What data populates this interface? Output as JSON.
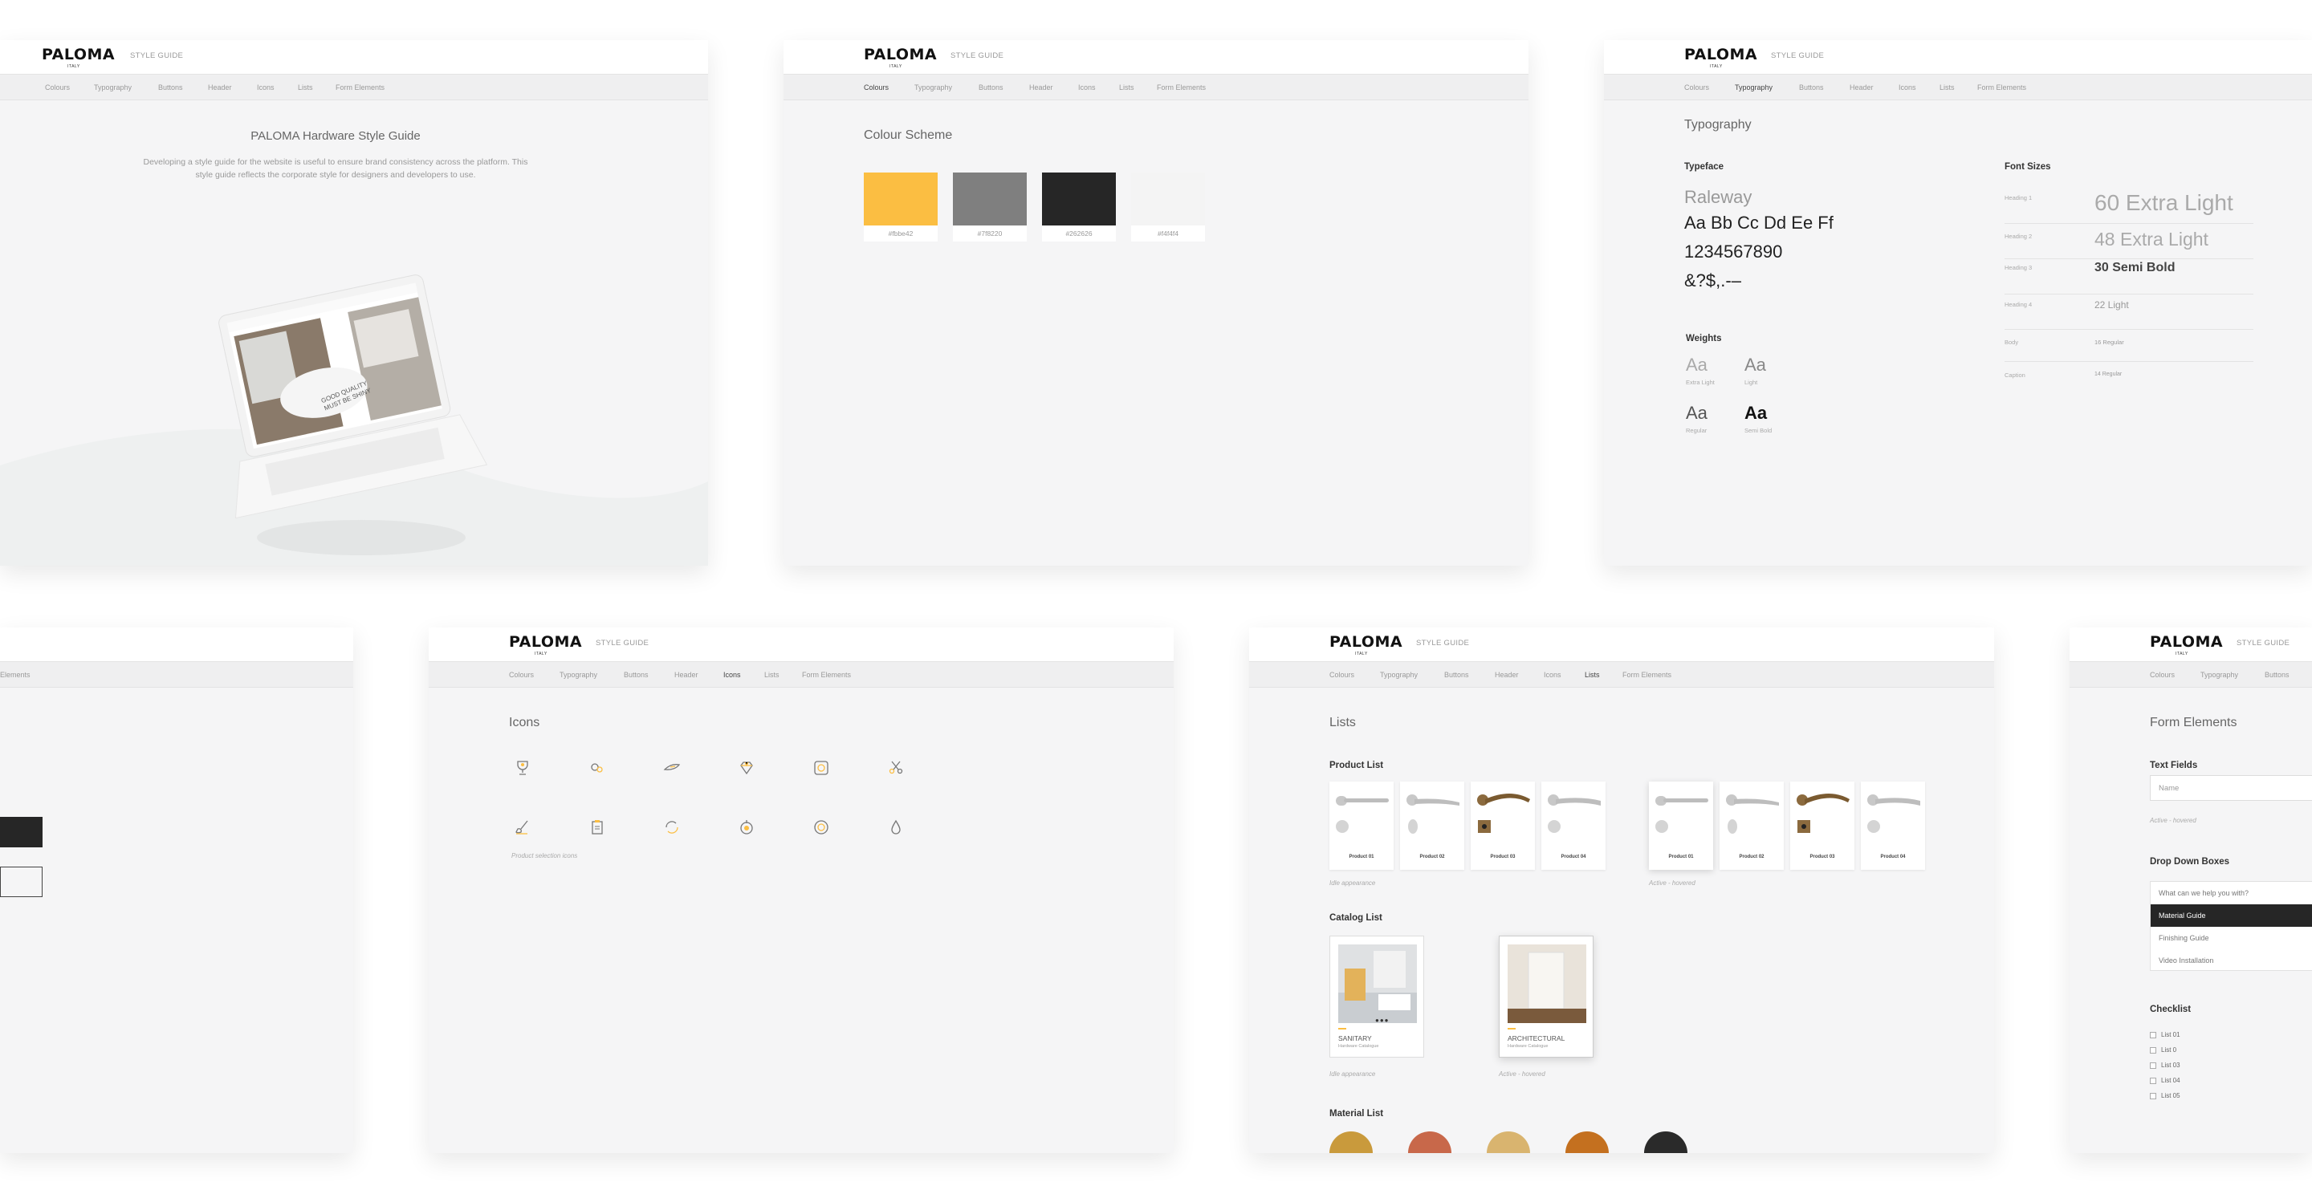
{
  "brand": {
    "logo": "PALOMA",
    "logo_sub": "ITALY",
    "section_label": "STYLE GUIDE"
  },
  "nav": [
    "Colours",
    "Typography",
    "Buttons",
    "Header",
    "Icons",
    "Lists",
    "Form Elements"
  ],
  "nav_partial": "Elements",
  "intro": {
    "title": "PALOMA Hardware Style Guide",
    "description_line1": "Developing a style guide for the website is useful to ensure brand consistency across the platform. This",
    "description_line2": "style guide reflects the corporate style for designers and developers to use.",
    "laptop_slogan": "GOOD QUALITY MUST BE SHINY"
  },
  "colours": {
    "title": "Colour Scheme",
    "swatches": [
      {
        "hex": "#fbbe42",
        "label": "#fbbe42"
      },
      {
        "hex": "#7f7f7f",
        "label": "#7f8220"
      },
      {
        "hex": "#262626",
        "label": "#262626"
      },
      {
        "hex": "#f4f4f4",
        "label": "#f4f4f4"
      }
    ]
  },
  "typography": {
    "title": "Typography",
    "typeface_heading": "Typeface",
    "typeface_name": "Raleway",
    "sample_letters": "Aa Bb Cc Dd Ee Ff",
    "sample_numbers": "1234567890",
    "sample_symbols": "&?$,.-–",
    "weights_heading": "Weights",
    "weights": [
      {
        "sample": "Aa",
        "label": "Extra Light"
      },
      {
        "sample": "Aa",
        "label": "Light"
      },
      {
        "sample": "Aa",
        "label": "Regular"
      },
      {
        "sample": "Aa",
        "label": "Semi Bold"
      }
    ],
    "sizes_heading": "Font Sizes",
    "sizes": [
      {
        "name": "Heading 1",
        "sample": "60 Extra Light"
      },
      {
        "name": "Heading 2",
        "sample": "48 Extra Light"
      },
      {
        "name": "Heading 3",
        "sample": "30 Semi Bold"
      },
      {
        "name": "Heading 4",
        "sample": "22 Light"
      },
      {
        "name": "Body",
        "sample": "16 Regular"
      },
      {
        "name": "Caption",
        "sample": "14 Regular"
      }
    ]
  },
  "icons": {
    "title": "Icons",
    "caption": "Product selection icons",
    "items": [
      "trophy-icon",
      "tools-icon",
      "wing-icon",
      "diamond-icon",
      "camera-icon",
      "scissors-icon",
      "brush-icon",
      "clipboard-icon",
      "refresh-icon",
      "badge-icon",
      "target-icon",
      "drop-icon"
    ]
  },
  "lists": {
    "title": "Lists",
    "product_heading": "Product List",
    "products": [
      "Product 01",
      "Product 02",
      "Product 03",
      "Product 04"
    ],
    "idle_caption": "Idle appearance",
    "hover_caption": "Active - hovered",
    "catalog_heading": "Catalog List",
    "catalogs": [
      {
        "title": "SANITARY",
        "subtitle": "Hardware Catalogue"
      },
      {
        "title": "ARCHITECTURAL",
        "subtitle": "Hardware Catalogue"
      }
    ],
    "material_heading": "Material List",
    "materials": [
      "#c99a3c",
      "#c8684a",
      "#d9b46f",
      "#c4701f",
      "#2a2a2a"
    ]
  },
  "forms": {
    "title": "Form Elements",
    "text_fields_heading": "Text Fields",
    "name_placeholder": "Name",
    "hover_caption": "Active - hovered",
    "dropdown_heading": "Drop Down Boxes",
    "dropdown_options": [
      "What can we help you with?",
      "Material Guide",
      "Finishing Guide",
      "Video Installation"
    ],
    "checklist_heading": "Checklist",
    "checklist": [
      "List 01",
      "List 0",
      "List 03",
      "List 04",
      "List 05"
    ]
  }
}
